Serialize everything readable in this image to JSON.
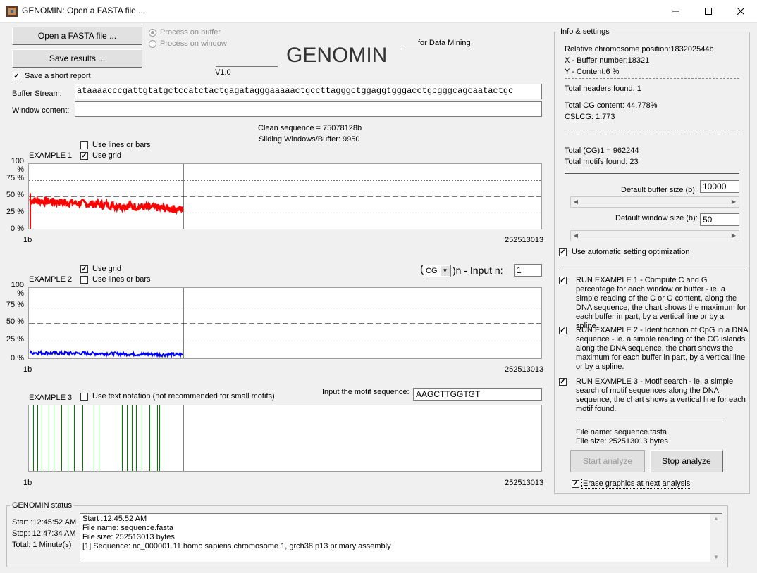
{
  "window": {
    "title": "GENOMIN: Open a FASTA file ...",
    "minimize_icon": "minimize-icon",
    "maximize_icon": "maximize-icon",
    "close_icon": "close-icon"
  },
  "toolbar": {
    "open_label": "Open a FASTA file  ...",
    "save_label": "Save results  ...",
    "short_report_label": "Save a short report",
    "short_report_checked": "✓",
    "process_buffer_label": "Process on buffer",
    "process_window_label": "Process on window"
  },
  "brand": {
    "name": "GENOMIN",
    "version": "V1.0",
    "tagline": "for Data Mining"
  },
  "stream": {
    "buffer_label": "Buffer Stream:",
    "buffer_value": "ataaaacccgattgtatgctccatctactgagatagggaaaaactgccttagggctggaggtgggacctgcgggcagcaatactgc",
    "window_label": "Window content:",
    "window_value": ""
  },
  "summary": {
    "clean_sequence": "Clean sequence = 75078128b",
    "sliding": "Sliding Windows/Buffer: 9950"
  },
  "example1": {
    "title": "EXAMPLE 1",
    "lines_bars_label": "Use lines or bars",
    "grid_label": "Use grid",
    "grid_checked": "✓",
    "x_start": "1b",
    "x_end": "252513013",
    "color": "#ff0000"
  },
  "example2": {
    "title": "EXAMPLE 2",
    "grid_label": "Use grid",
    "grid_checked": "✓",
    "lines_bars_label": "Use lines or bars",
    "motif_paren_open": "(",
    "motif_select": "CG",
    "motif_suffix": ")n - Input n:",
    "input_n": "1",
    "x_start": "1b",
    "x_end": "252513013",
    "color": "#0000ff"
  },
  "example3": {
    "title": "EXAMPLE 3",
    "text_notation_label": "Use text notation (not recommended for small motifs)",
    "motif_label": "Input the motif sequence:",
    "motif_value": "AAGCTTGGTGT",
    "x_start": "1b",
    "x_end": "252513013",
    "color": "#008000"
  },
  "y_ticks": [
    "100 %",
    "75 %",
    "50 %",
    "25 %",
    "0 %"
  ],
  "settings": {
    "title": "Info & settings",
    "rel_position": "Relative chromosome position:183202544b",
    "buffer_number": "X - Buffer number:18321",
    "content": "Y - Content:6 %",
    "headers_found": "Total headers found: 1",
    "cg_content": "Total CG content: 44.778%",
    "cslcg": "CSLCG: 1.773",
    "total_cg1": "Total (CG)1 = 962244",
    "total_motifs": "Total motifs found: 23",
    "buffer_size_label": "Default buffer size (b):",
    "buffer_size_value": "10000",
    "window_size_label": "Default window size (b):",
    "window_size_value": "50",
    "auto_opt_label": "Use automatic setting optimization",
    "auto_opt_checked": "✓",
    "run1": "RUN EXAMPLE 1 - Compute C and G percentage for each window or buffer - ie. a simple reading of the C or G content, along the DNA sequence, the chart shows the maximum for each buffer in part, by a vertical line or by a spline.",
    "run2": "RUN EXAMPLE 2 - Identification of CpG in a DNA sequence  -  ie. a simple reading of the CG islands along the DNA sequence, the chart shows the maximum for each buffer in part, by a vertical line or by a spline.",
    "run3": "RUN EXAMPLE 3 - Motif search -  ie. a simple search of  motif sequences along the DNA sequence, the chart shows a vertical line for each motif found.",
    "run_checked": "✓",
    "file_name": "File name: sequence.fasta",
    "file_size": "File size: 252513013 bytes",
    "start_label": "Start analyze",
    "stop_label": "Stop analyze",
    "erase_label": "Erase graphics at next analysis",
    "erase_checked": "✓"
  },
  "status": {
    "title": "GENOMIN status",
    "start": "Start :12:45:52 AM",
    "stop": "Stop: 12:47:34 AM",
    "total": "Total: 1 Minute(s)",
    "log": [
      "Start :12:45:52 AM",
      "File name: sequence.fasta",
      "File size: 252513013 bytes",
      "[1] Sequence: nc_000001.11 homo sapiens chromosome 1, grch38.p13 primary assembly"
    ]
  }
}
